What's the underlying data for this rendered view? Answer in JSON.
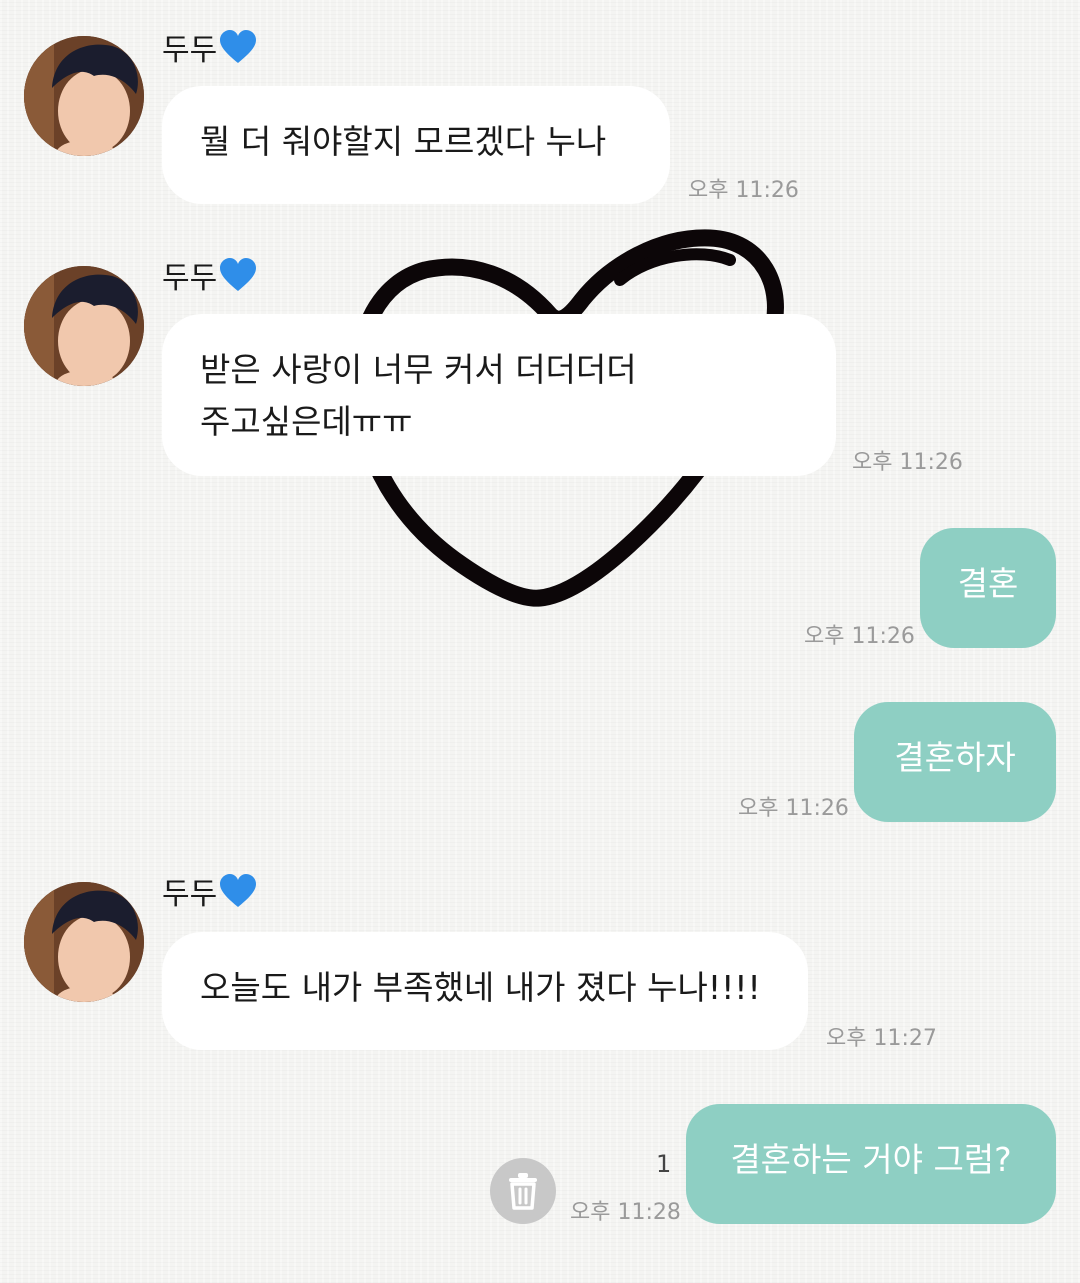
{
  "messages": [
    {
      "sender": "두두",
      "text": "뭘 더 줘야할지 모르겠다 누나",
      "time": "오후 11:26"
    },
    {
      "sender": "두두",
      "line1": "받은 사랑이 너무 커서 더더더더",
      "line2": "주고싶은데ㅠㅠ",
      "time": "오후 11:26"
    },
    {
      "text": "결혼",
      "time": "오후 11:26"
    },
    {
      "text": "결혼하자",
      "time": "오후 11:26"
    },
    {
      "sender": "두두",
      "text": "오늘도 내가 부족했네 내가 졌다 누나!!!!",
      "time": "오후 11:27"
    },
    {
      "text": "결혼하는 거야 그럼?",
      "time": "오후 11:28",
      "unread": "1"
    }
  ],
  "colors": {
    "outgoing_bubble": "#8ecfc3",
    "incoming_bubble": "#ffffff",
    "heart_emoji": "#2f8ee9"
  },
  "icons": {
    "sender_heart": "blue-heart-icon",
    "delete": "trash-icon"
  }
}
